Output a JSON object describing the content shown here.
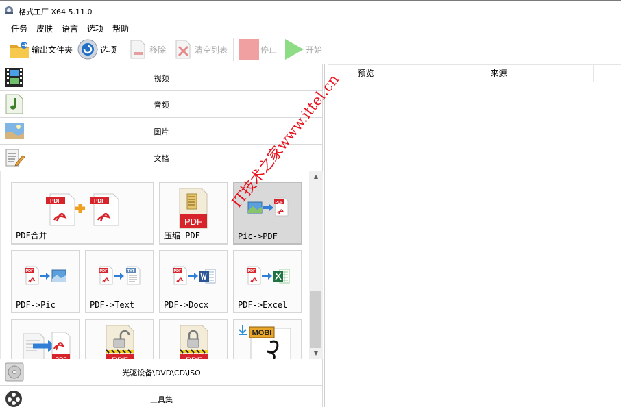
{
  "window": {
    "title": "格式工厂 X64 5.11.0"
  },
  "menu": [
    "任务",
    "皮肤",
    "语言",
    "选项",
    "帮助"
  ],
  "toolbar": {
    "output_folder": "输出文件夹",
    "options": "选项",
    "remove": "移除",
    "clear_list": "清空列表",
    "stop": "停止",
    "start": "开始"
  },
  "categories": {
    "video": "视频",
    "audio": "音频",
    "picture": "图片",
    "document": "文档",
    "rom_device": "光驱设备\\DVD\\CD\\ISO",
    "toolbox": "工具集"
  },
  "tiles": [
    {
      "label": "PDF合并",
      "icon": "pdf-merge-icon"
    },
    {
      "label": "压缩 PDF",
      "icon": "compress-pdf-icon"
    },
    {
      "label": "Pic->PDF",
      "icon": "pic-to-pdf-icon"
    },
    {
      "label": "PDF->Pic",
      "icon": "pdf-to-pic-icon"
    },
    {
      "label": "PDF->Text",
      "icon": "pdf-to-text-icon"
    },
    {
      "label": "PDF->Docx",
      "icon": "pdf-to-docx-icon"
    },
    {
      "label": "PDF->Excel",
      "icon": "pdf-to-excel-icon"
    },
    {
      "label": "",
      "icon": "doc-to-pdf-icon"
    },
    {
      "label": "",
      "icon": "pdf-unlock-icon"
    },
    {
      "label": "",
      "icon": "pdf-lock-icon"
    },
    {
      "label": "",
      "icon": "mobi-ebook-icon"
    }
  ],
  "tile_icon_texts": {
    "pdf": "PDF",
    "txt": "TXT",
    "mobi": "MOBI"
  },
  "task_table": {
    "columns": [
      "预览",
      "来源"
    ]
  },
  "watermark": "IT技术之家www.ittel.cn",
  "colors": {
    "pdf_red": "#d7242b",
    "arrow_blue": "#2f7fd6",
    "start_green": "#46c43a",
    "stop_red": "#f0a0a0",
    "watermark": "#e8000b"
  }
}
